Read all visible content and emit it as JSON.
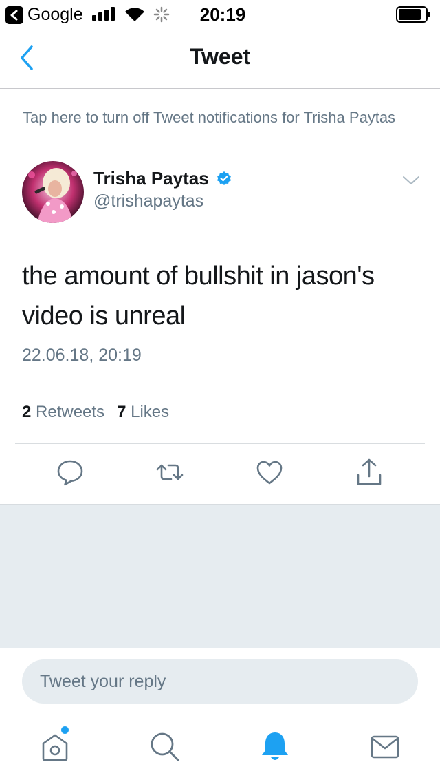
{
  "status_bar": {
    "back_app": "Google",
    "time": "20:19"
  },
  "nav": {
    "title": "Tweet"
  },
  "notification_banner": {
    "text": "Tap here to turn off Tweet notifications for Trisha Paytas"
  },
  "tweet": {
    "author_name": "Trisha Paytas",
    "author_handle": "@trishapaytas",
    "verified": true,
    "text": "the amount of bullshit in jason's video is unreal",
    "timestamp": "22.06.18, 20:19",
    "retweets_count": "2",
    "retweets_label": "Retweets",
    "likes_count": "7",
    "likes_label": "Likes"
  },
  "reply": {
    "placeholder": "Tweet your reply"
  },
  "colors": {
    "accent": "#1da1f2",
    "text_primary": "#14171a",
    "text_secondary": "#657786",
    "background_grey": "#e6ecf0"
  },
  "icons": {
    "actions": [
      "reply-icon",
      "retweet-icon",
      "like-icon",
      "share-icon"
    ],
    "tabs": [
      "home-icon",
      "search-icon",
      "notifications-icon",
      "messages-icon"
    ]
  }
}
